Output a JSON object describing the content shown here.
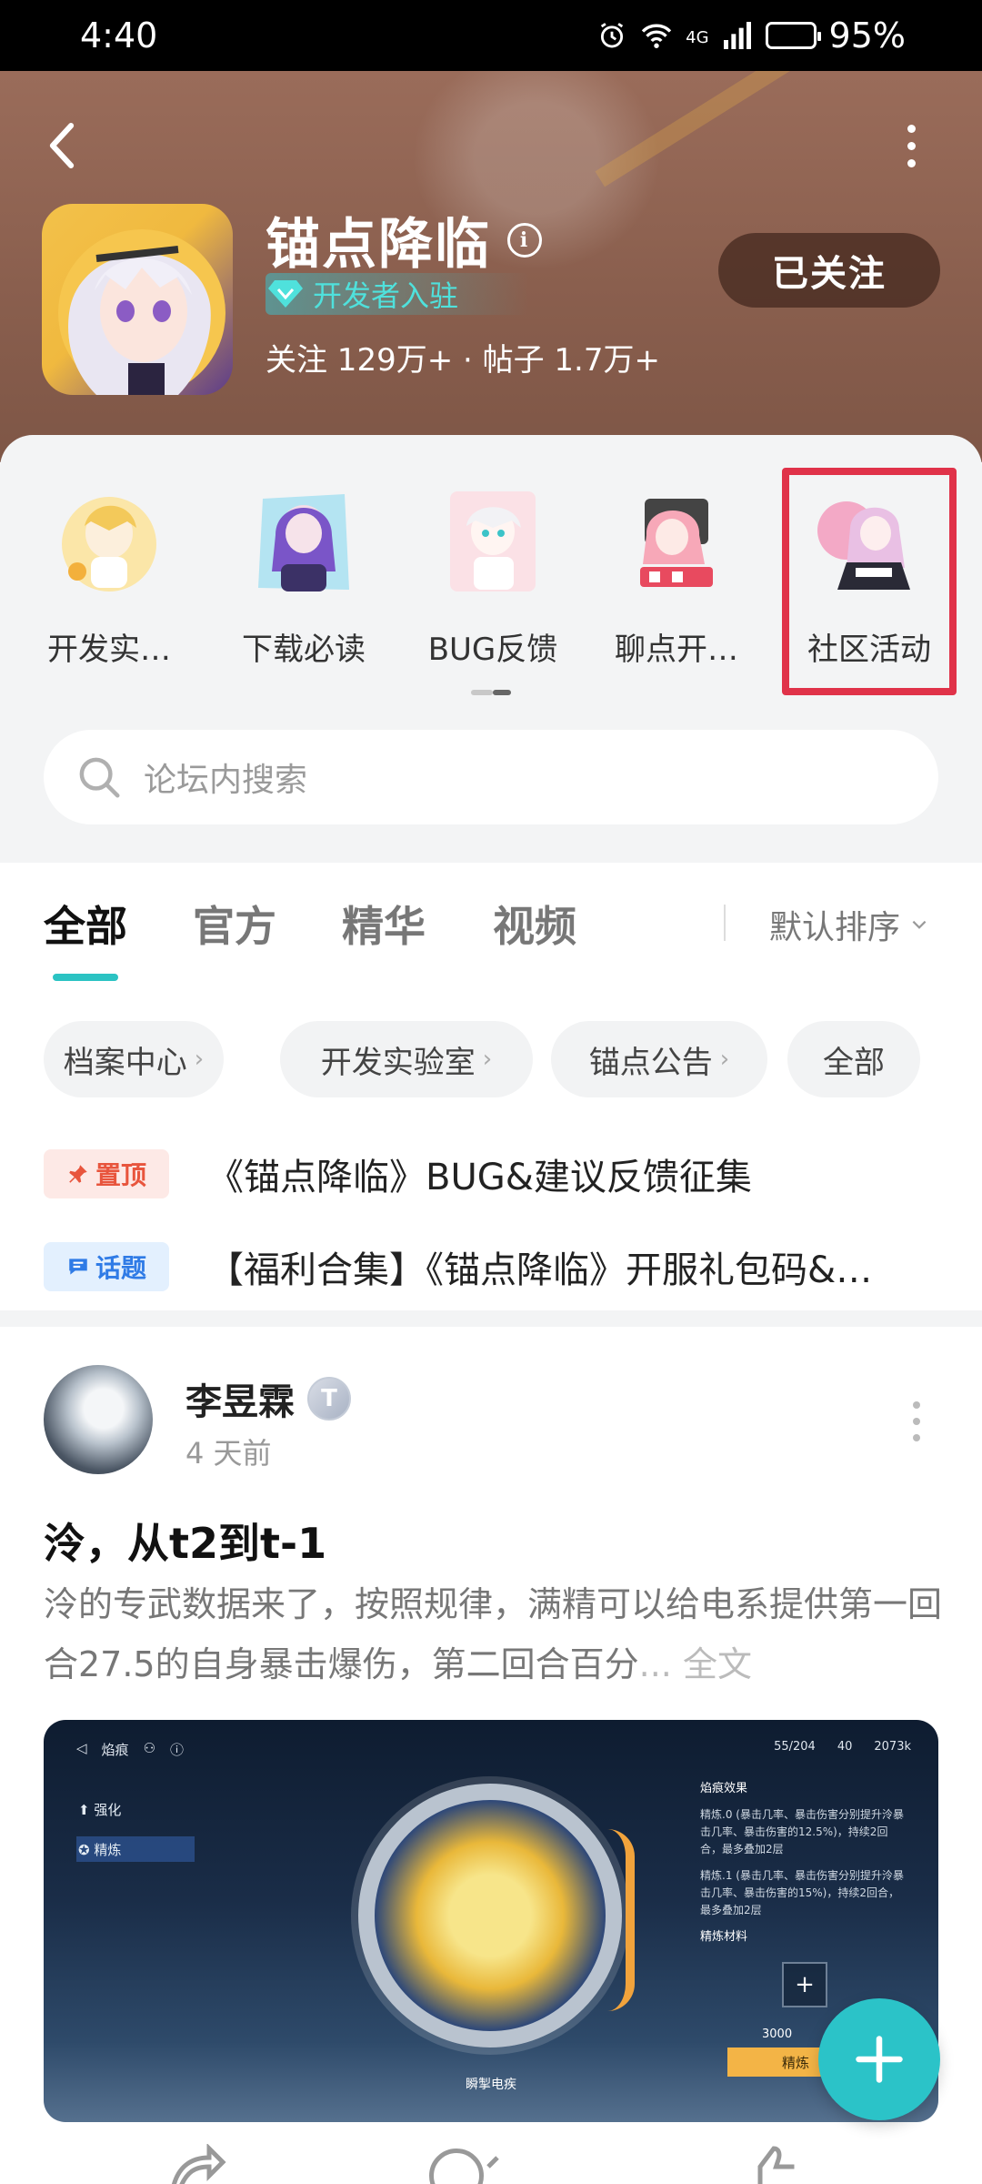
{
  "status_bar": {
    "time": "4:40",
    "network": "4G",
    "battery": "95%",
    "battery_level": 0.95
  },
  "header": {
    "title": "锚点降临",
    "badge": "开发者入驻",
    "stats": "关注 129万+ · 帖子 1.7万+",
    "follow_label": "已关注"
  },
  "categories": [
    {
      "label": "开发实…"
    },
    {
      "label": "下载必读"
    },
    {
      "label": "BUG反馈"
    },
    {
      "label": "聊点开…"
    },
    {
      "label": "社区活动"
    }
  ],
  "search": {
    "placeholder": "论坛内搜索"
  },
  "tabs": {
    "items": [
      "全部",
      "官方",
      "精华",
      "视频"
    ],
    "active": "全部",
    "sort": "默认排序"
  },
  "chips": [
    "档案中心",
    "开发实验室",
    "锚点公告",
    "全部"
  ],
  "pinned": [
    {
      "tag": "置顶",
      "title": "《锚点降临》BUG&建议反馈征集"
    },
    {
      "tag": "话题",
      "title": "【福利合集】《锚点降临》开服礼包码&…"
    }
  ],
  "post": {
    "author": "李昱霖",
    "level": "T",
    "time": "4 天前",
    "title": "泠，从t2到t-1",
    "body": "泠的专武数据来了，按照规律，满精可以给电系提供第一回合27.5的自身暴击爆伤，第二回合百分",
    "more": "... 全文",
    "image": {
      "weapon_name": "焰痕",
      "resources": [
        "55/204",
        "40",
        "2073k"
      ],
      "menu": [
        "强化",
        "精炼"
      ],
      "effect_title": "焰痕效果",
      "effect_lines": [
        "精炼.0 (暴击几率、暴击伤害分别提升泠暴击几率、暴击伤害的12.5%)，持续2回合，最多叠加2层",
        "精炼.1 (暴击几率、暴击伤害分别提升泠暴击几率、暴击伤害的15%)，持续2回合，最多叠加2层"
      ],
      "materials_title": "精炼材料",
      "cost": "3000",
      "button": "精炼",
      "caption": "瞬掣电疾"
    }
  },
  "colors": {
    "accent": "#2bc3c8",
    "highlight": "#e03249",
    "header_bg": "#8a5f4e"
  }
}
